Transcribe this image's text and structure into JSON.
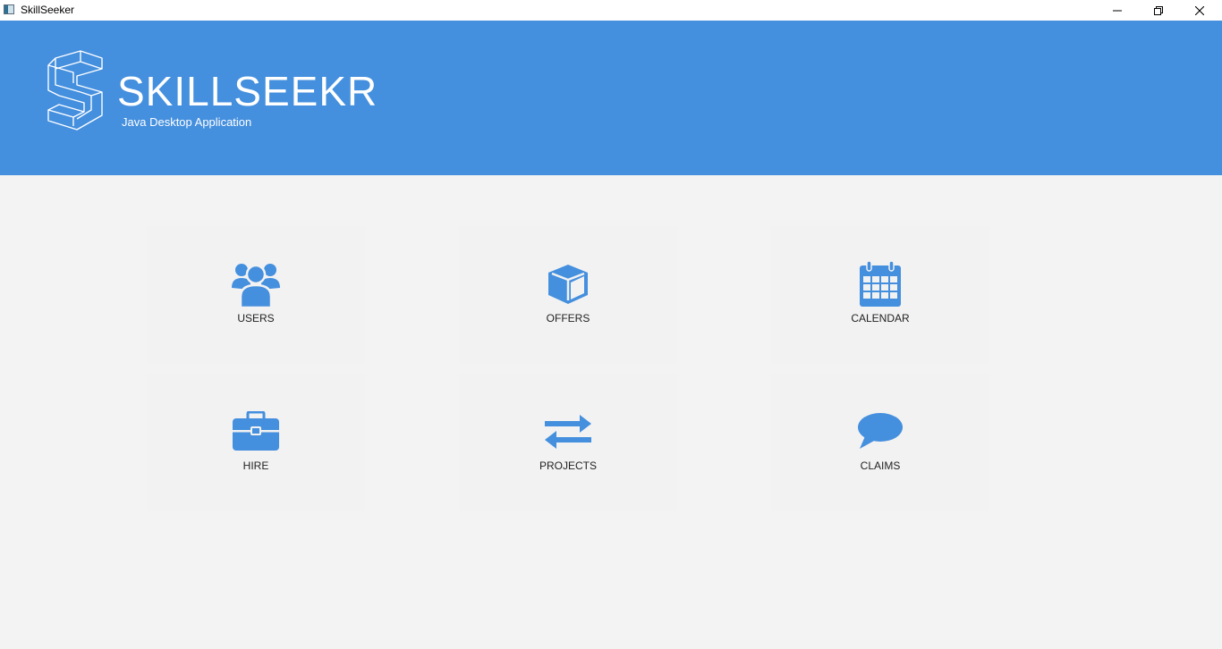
{
  "window": {
    "title": "SkillSeeker"
  },
  "header": {
    "brand": "SKILLSEEKR",
    "tagline": "Java Desktop Application",
    "background_color": "#448fde"
  },
  "colors": {
    "accent": "#448fde",
    "page_background": "#f3f3f3",
    "tile_background": "#f2f2f2"
  },
  "tiles": [
    {
      "label": "USERS",
      "icon": "users-icon"
    },
    {
      "label": "OFFERS",
      "icon": "cube-icon"
    },
    {
      "label": "CALENDAR",
      "icon": "calendar-icon"
    },
    {
      "label": "HIRE",
      "icon": "briefcase-icon"
    },
    {
      "label": "PROJECTS",
      "icon": "exchange-arrows-icon"
    },
    {
      "label": "CLAIMS",
      "icon": "speech-bubble-icon"
    }
  ]
}
